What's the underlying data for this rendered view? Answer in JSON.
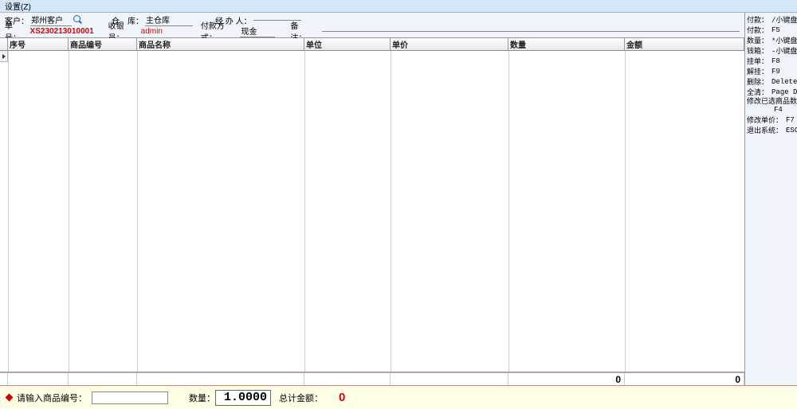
{
  "menubar": {
    "settings": "设置(Z)"
  },
  "header": {
    "customer_label": "客户：",
    "customer_value": "郑州客户",
    "warehouse_label": "仓　库：",
    "warehouse_value": "主仓库",
    "handler_label": "经 办 人：",
    "handler_value": "",
    "orderno_label": "单号：",
    "orderno_value": "XS230213010001",
    "cashier_label": "收银员：",
    "cashier_value": "admin",
    "paytype_label": "付款方式：",
    "paytype_value": "现金",
    "note_label": "备　注：",
    "note_value": ""
  },
  "columns": {
    "seq": "序号",
    "code": "商品编号",
    "name": "商品名称",
    "unit": "单位",
    "price": "单价",
    "qty": "数量",
    "amt": "金额"
  },
  "totals": {
    "qty": "0",
    "amt": "0"
  },
  "footer": {
    "prompt": "请输入商品编号：",
    "qty_label": "数量：",
    "qty_value": "1.0000",
    "total_amt_label": "总计金额：",
    "total_amt_value": "0"
  },
  "shortcuts": [
    {
      "lbl": "付款：",
      "key": "/小键盘"
    },
    {
      "lbl": "付款：",
      "key": "F5"
    },
    {
      "lbl": "数量：",
      "key": "*小键盘"
    },
    {
      "lbl": "钱箱：",
      "key": "-小键盘"
    },
    {
      "lbl": "挂单：",
      "key": "F8"
    },
    {
      "lbl": "解挂：",
      "key": "F9"
    },
    {
      "lbl": "删除：",
      "key": "Delete"
    },
    {
      "lbl": "全清：",
      "key": "Page Down"
    },
    {
      "lbl": "修改已选商品数量：",
      "key": "F4",
      "split": true
    },
    {
      "lbl": "修改单价：",
      "key": "F7"
    },
    {
      "lbl": "退出系统：",
      "key": "ESC"
    }
  ]
}
